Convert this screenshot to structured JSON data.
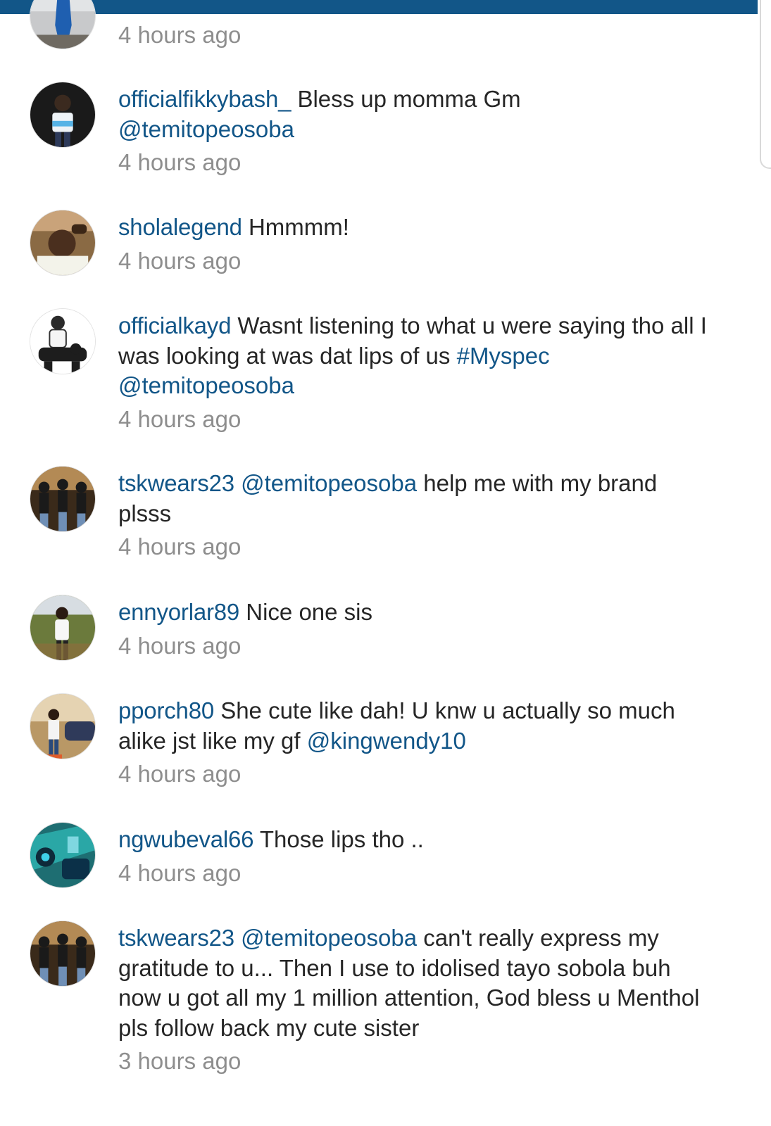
{
  "colors": {
    "brand": "#125688",
    "text": "#262626",
    "muted": "#8e8e8e"
  },
  "comments": [
    {
      "avatar": "avatar-blue-figure",
      "timestamp": "4 hours ago"
    },
    {
      "avatar": "avatar-dark-portrait",
      "username": "officialfikkybash_",
      "segments": [
        "Bless up momma Gm",
        "@temitopeosoba"
      ],
      "timestamp": "4 hours ago"
    },
    {
      "avatar": "avatar-selfie",
      "username": "sholalegend",
      "segments": [
        "Hmmmm!"
      ],
      "timestamp": "4 hours ago"
    },
    {
      "avatar": "avatar-group-white",
      "username": "officialkayd",
      "segments": [
        "Wasnt listening to what u were saying tho all I was looking at was dat lips of us",
        "#Myspec",
        "@temitopeosoba"
      ],
      "timestamp": "4 hours ago"
    },
    {
      "avatar": "avatar-group-three",
      "username": "tskwears23",
      "segments": [
        "@temitopeosoba",
        "help me with my brand plsss"
      ],
      "timestamp": "4 hours ago"
    },
    {
      "avatar": "avatar-outdoor-white",
      "username": "ennyorlar89",
      "segments": [
        "Nice one sis"
      ],
      "timestamp": "4 hours ago"
    },
    {
      "avatar": "avatar-car-portrait",
      "username": "pporch80",
      "segments": [
        "She cute like dah! U knw u actually so much alike jst like my gf",
        "@kingwendy10"
      ],
      "timestamp": "4 hours ago"
    },
    {
      "avatar": "avatar-teal-graphic",
      "username": "ngwubeval66",
      "segments": [
        "Those lips tho .."
      ],
      "timestamp": "4 hours ago"
    },
    {
      "avatar": "avatar-group-three",
      "username": "tskwears23",
      "segments": [
        "@temitopeosoba",
        "can't really express my gratitude to u... Then I use to idolised tayo sobola buh now u got all my 1 million attention, God bless u Menthol pls follow back my cute sister"
      ],
      "timestamp": "3 hours ago"
    }
  ]
}
